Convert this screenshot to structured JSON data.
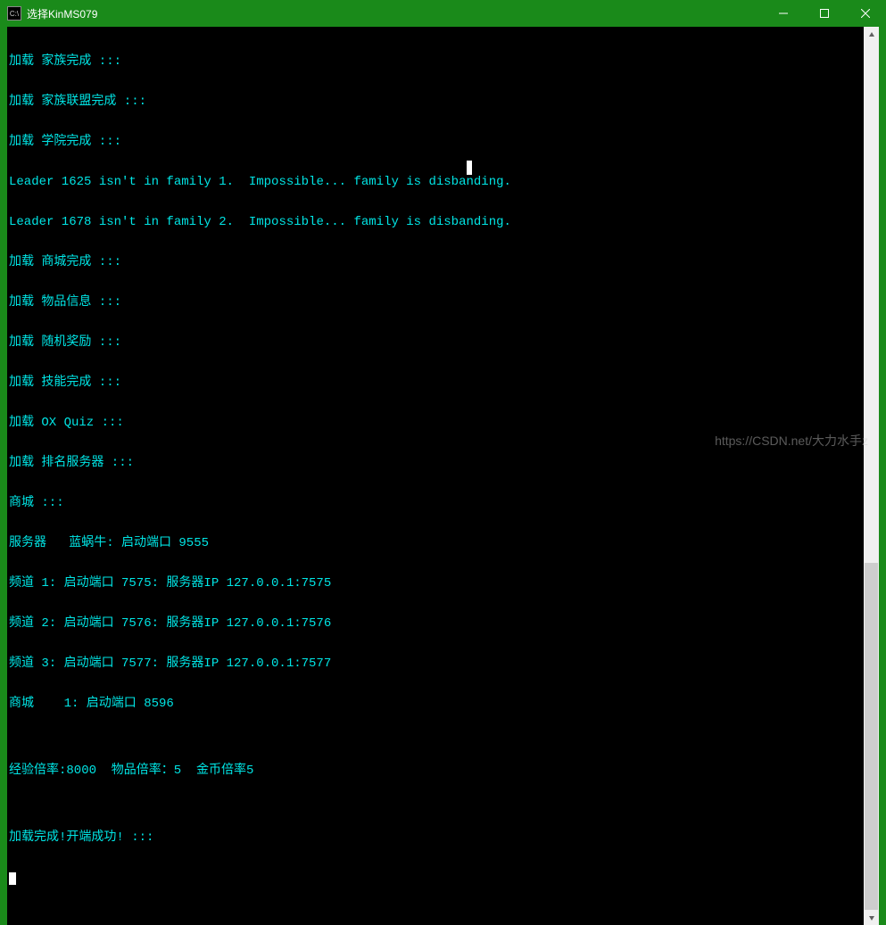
{
  "window": {
    "icon_label": "C:\\",
    "title": "选择KinMS079"
  },
  "console": {
    "lines": [
      "加载 家族完成 :::",
      "加载 家族联盟完成 :::",
      "加载 学院完成 :::",
      "Leader 1625 isn't in family 1.  Impossible... family is disbanding.",
      "Leader 1678 isn't in family 2.  Impossible... family is disbanding.",
      "加载 商城完成 :::",
      "加载 物品信息 :::",
      "加载 随机奖励 :::",
      "加载 技能完成 :::",
      "加载 OX Quiz :::",
      "加载 排名服务器 :::",
      "商城 :::",
      "服务器   蓝蜗牛: 启动端口 9555",
      "频道 1: 启动端口 7575: 服务器IP 127.0.0.1:7575",
      "频道 2: 启动端口 7576: 服务器IP 127.0.0.1:7576",
      "频道 3: 启动端口 7577: 服务器IP 127.0.0.1:7577",
      "商城    1: 启动端口 8596",
      "",
      "经验倍率:8000  物品倍率：5  金币倍率5",
      "",
      "加载完成!开端成功! :::"
    ]
  },
  "rates": {
    "exp": 8000,
    "item": 5,
    "gold": 5
  },
  "server": {
    "name": "蓝蜗牛",
    "port": 9555,
    "channels": [
      {
        "id": 1,
        "port": 7575,
        "ip": "127.0.0.1:7575"
      },
      {
        "id": 2,
        "port": 7576,
        "ip": "127.0.0.1:7576"
      },
      {
        "id": 3,
        "port": 7577,
        "ip": "127.0.0.1:7577"
      }
    ],
    "mall_port": 8596
  },
  "watermark": "https://CSDN.net/大力水手z"
}
